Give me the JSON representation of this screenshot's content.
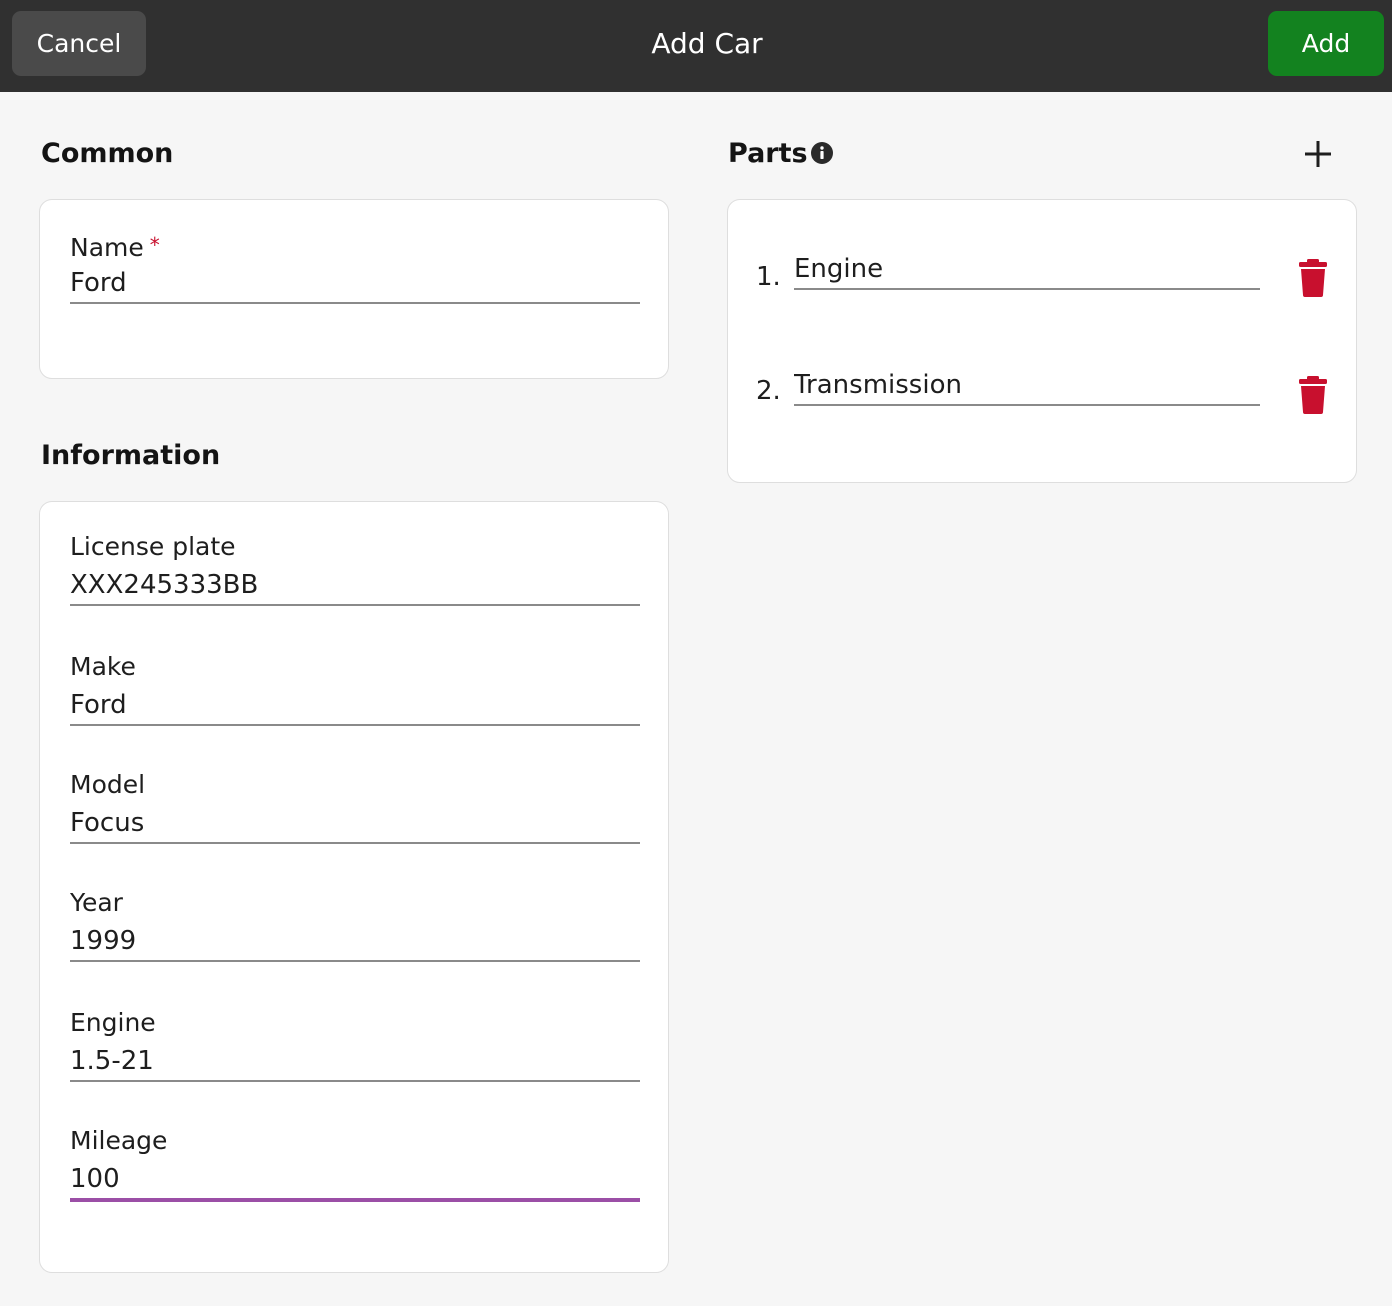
{
  "header": {
    "cancel_label": "Cancel",
    "title": "Add Car",
    "add_label": "Add"
  },
  "common": {
    "section_title": "Common",
    "name": {
      "label": "Name",
      "required_marker": "*",
      "value": "Ford"
    }
  },
  "information": {
    "section_title": "Information",
    "fields": [
      {
        "label": "License plate",
        "value": "XXX245333BB"
      },
      {
        "label": "Make",
        "value": "Ford"
      },
      {
        "label": "Model",
        "value": "Focus"
      },
      {
        "label": "Year",
        "value": "1999"
      },
      {
        "label": "Engine",
        "value": "1.5-21"
      },
      {
        "label": "Mileage",
        "value": "100",
        "focused": true
      }
    ]
  },
  "parts": {
    "section_title": "Parts",
    "items": [
      {
        "number": "1.",
        "value": "Engine"
      },
      {
        "number": "2.",
        "value": "Transmission"
      }
    ]
  },
  "icons": {
    "info": "info-circle-icon",
    "add": "plus-icon",
    "delete": "trash-icon"
  },
  "colors": {
    "header_bg": "#303030",
    "add_button": "#13821f",
    "delete_icon": "#c8102e",
    "focus_underline": "#9b4fa6",
    "required_star": "#c8102e"
  }
}
